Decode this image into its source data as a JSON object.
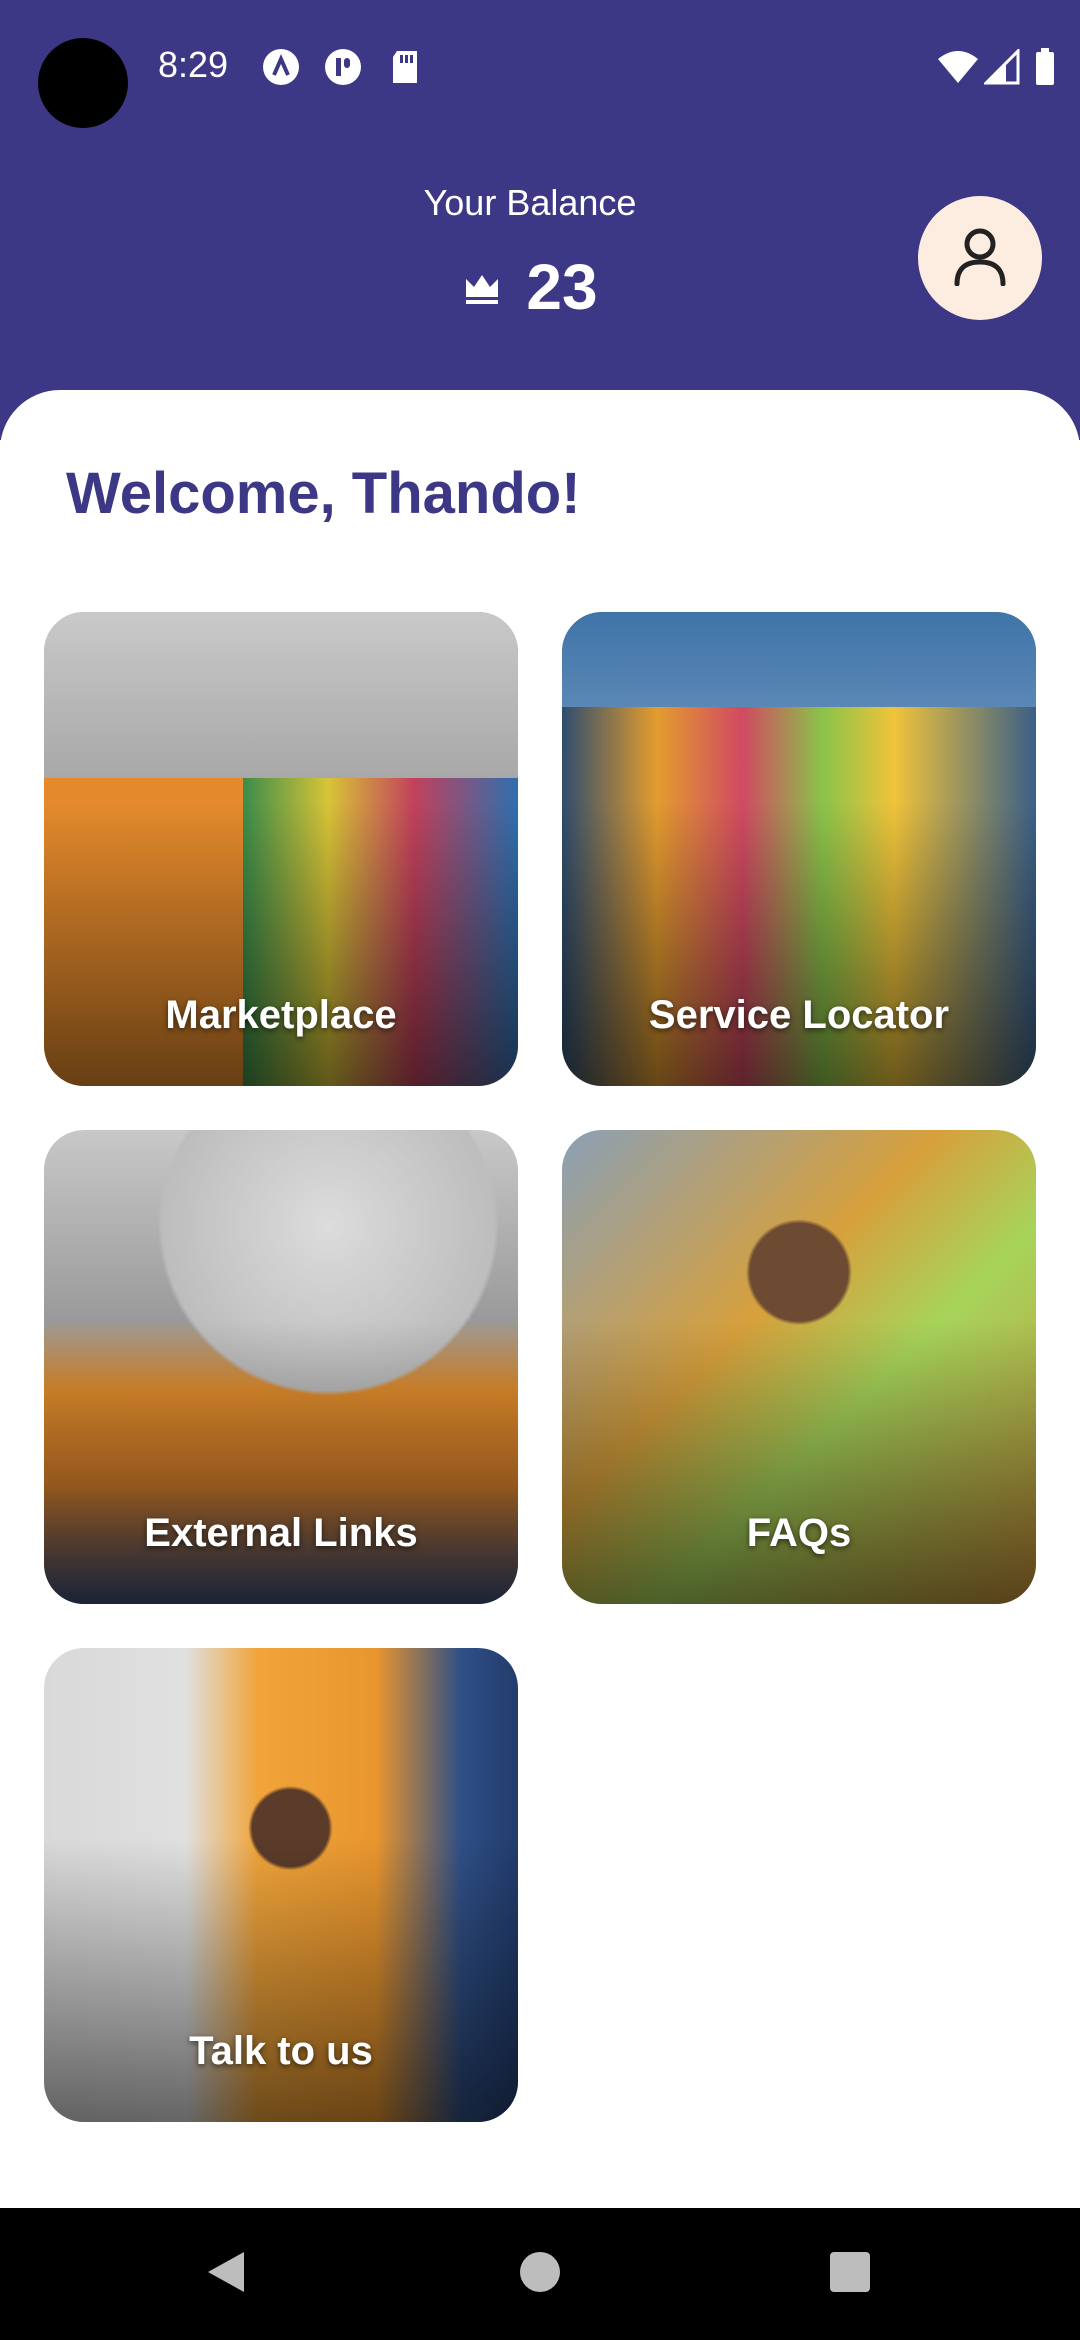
{
  "status_bar": {
    "time": "8:29"
  },
  "header": {
    "balance_label": "Your Balance",
    "balance_value": "23"
  },
  "main": {
    "welcome": "Welcome, Thando!",
    "tiles": [
      {
        "label": "Marketplace"
      },
      {
        "label": "Service Locator"
      },
      {
        "label": "External Links"
      },
      {
        "label": "FAQs"
      },
      {
        "label": "Talk to us"
      }
    ]
  },
  "colors": {
    "header_bg": "#3d3885",
    "welcome_text": "#3d3885",
    "avatar_bg": "#fdece0"
  },
  "icons": {
    "status_left": [
      "a-icon",
      "p-icon",
      "sd-card-icon"
    ],
    "status_right": [
      "wifi-icon",
      "signal-icon",
      "battery-icon"
    ],
    "balance": "crown-icon",
    "profile": "person-icon",
    "nav": [
      "back-icon",
      "home-icon",
      "recents-icon"
    ]
  }
}
